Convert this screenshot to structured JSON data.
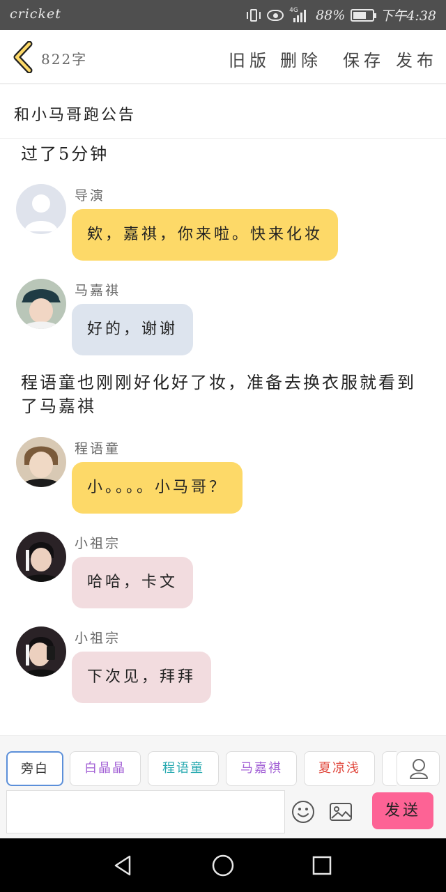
{
  "status": {
    "carrier": "cricket",
    "network": "4G",
    "battery": "88%",
    "time": "下午4:38"
  },
  "toolbar": {
    "word_count": "822字",
    "old_version": "旧版",
    "delete": "删除",
    "save": "保存",
    "publish": "发布"
  },
  "title": "和小马哥跑公告",
  "story": {
    "narration_1": "过了5分钟",
    "narration_2": "程语童也刚刚好化好了妆，准备去换衣服就看到了马嘉祺",
    "messages": [
      {
        "speaker": "导演",
        "text": "欸，嘉祺，你来啦。快来化妆",
        "color": "yellow"
      },
      {
        "speaker": "马嘉祺",
        "text": "好的，谢谢",
        "color": "blue"
      },
      {
        "speaker": "程语童",
        "text": "小。。。。小马哥？",
        "color": "yellow"
      },
      {
        "speaker": "小祖宗",
        "text": "哈哈，卡文",
        "color": "pink"
      },
      {
        "speaker": "小祖宗",
        "text": "下次见，拜拜",
        "color": "pink"
      }
    ]
  },
  "characters": [
    {
      "label": "旁白",
      "color": "#333333",
      "selected": true
    },
    {
      "label": "白晶晶",
      "color": "#a463d6"
    },
    {
      "label": "程语童",
      "color": "#27a9b0"
    },
    {
      "label": "马嘉祺",
      "color": "#a463d6"
    },
    {
      "label": "夏凉浅",
      "color": "#e0453a"
    }
  ],
  "composer": {
    "input_value": "",
    "send_label": "发送"
  },
  "colors": {
    "accent_yellow": "#fdd968",
    "bubble_blue": "#dde4ee",
    "bubble_pink": "#f2dcdf",
    "send_pink": "#fd6395"
  }
}
